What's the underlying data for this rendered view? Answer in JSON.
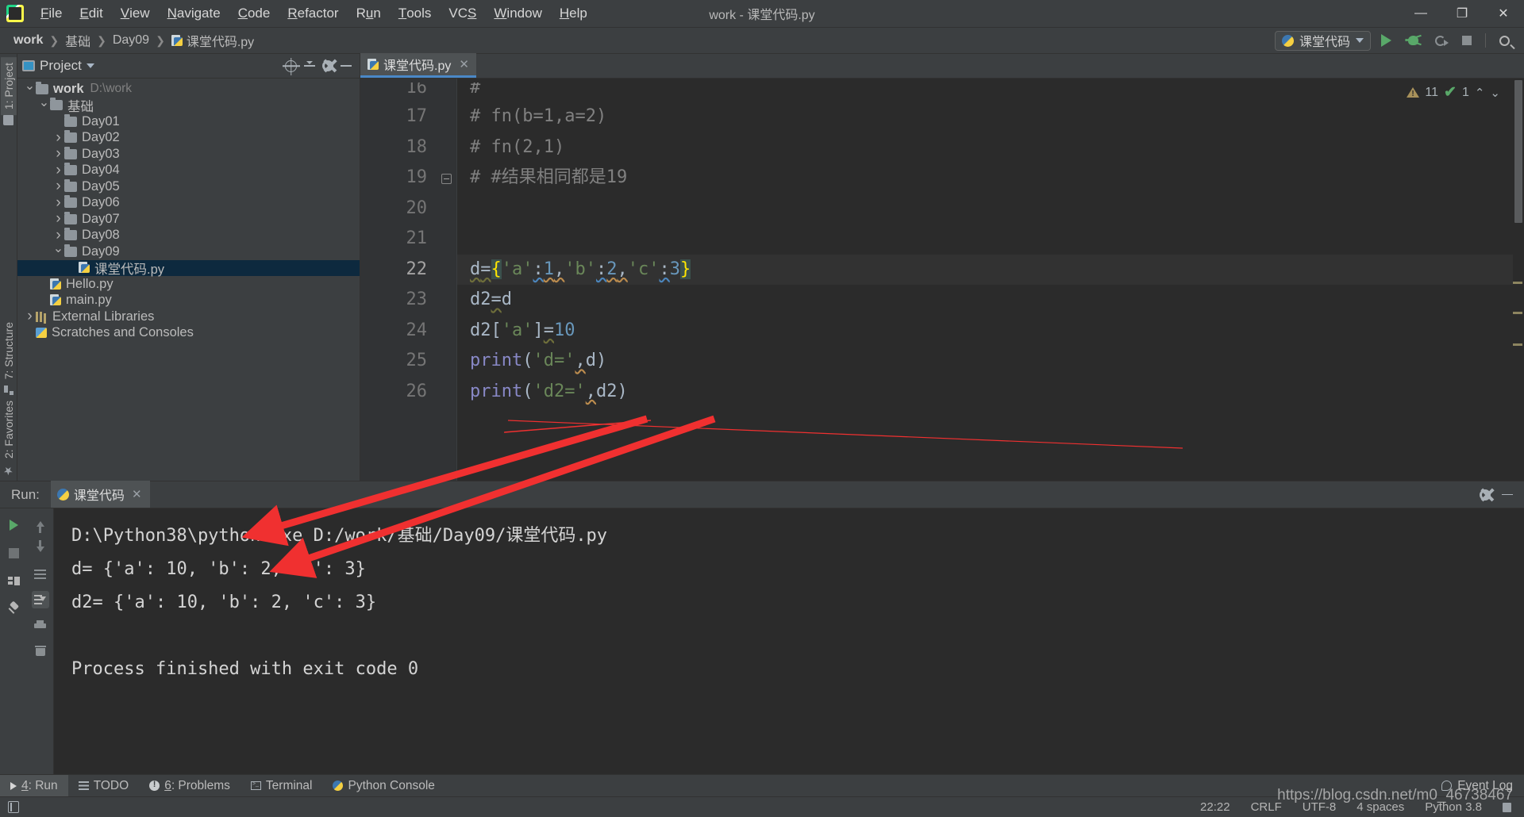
{
  "window": {
    "title": "work - 课堂代码.py",
    "app_icon": "pycharm-logo",
    "minimize": "—",
    "maximize": "❐",
    "close": "✕"
  },
  "menu": [
    {
      "label": "File"
    },
    {
      "label": "Edit"
    },
    {
      "label": "View"
    },
    {
      "label": "Navigate"
    },
    {
      "label": "Code"
    },
    {
      "label": "Refactor"
    },
    {
      "label": "Run"
    },
    {
      "label": "Tools"
    },
    {
      "label": "VCS"
    },
    {
      "label": "Window"
    },
    {
      "label": "Help"
    }
  ],
  "breadcrumb": {
    "items": [
      "work",
      "基础",
      "Day09"
    ],
    "file": "课堂代码.py",
    "separator": "❯"
  },
  "toolbar": {
    "run_config": "课堂代码",
    "run_button": "run-icon",
    "debug_button": "debug-icon",
    "coverage_button": "coverage-icon",
    "stop_button": "stop-icon",
    "search_button": "search-icon"
  },
  "left_strip": {
    "project_tab": "1: Project",
    "structure_tab": "7: Structure",
    "favorites_tab": "2: Favorites"
  },
  "project_panel": {
    "title": "Project",
    "tree": [
      {
        "label": "work",
        "path": "D:\\work",
        "depth": 0,
        "arrow": "down",
        "icon": "folder",
        "bold": true,
        "selected": false
      },
      {
        "label": "基础",
        "path": "",
        "depth": 1,
        "arrow": "down",
        "icon": "folder",
        "bold": false,
        "selected": false
      },
      {
        "label": "Day01",
        "path": "",
        "depth": 2,
        "arrow": "none",
        "icon": "folder",
        "bold": false,
        "selected": false
      },
      {
        "label": "Day02",
        "path": "",
        "depth": 2,
        "arrow": "right",
        "icon": "folder",
        "bold": false,
        "selected": false
      },
      {
        "label": "Day03",
        "path": "",
        "depth": 2,
        "arrow": "right",
        "icon": "folder",
        "bold": false,
        "selected": false
      },
      {
        "label": "Day04",
        "path": "",
        "depth": 2,
        "arrow": "right",
        "icon": "folder",
        "bold": false,
        "selected": false
      },
      {
        "label": "Day05",
        "path": "",
        "depth": 2,
        "arrow": "right",
        "icon": "folder",
        "bold": false,
        "selected": false
      },
      {
        "label": "Day06",
        "path": "",
        "depth": 2,
        "arrow": "right",
        "icon": "folder",
        "bold": false,
        "selected": false
      },
      {
        "label": "Day07",
        "path": "",
        "depth": 2,
        "arrow": "right",
        "icon": "folder",
        "bold": false,
        "selected": false
      },
      {
        "label": "Day08",
        "path": "",
        "depth": 2,
        "arrow": "right",
        "icon": "folder",
        "bold": false,
        "selected": false
      },
      {
        "label": "Day09",
        "path": "",
        "depth": 2,
        "arrow": "down",
        "icon": "folder",
        "bold": false,
        "selected": false
      },
      {
        "label": "课堂代码.py",
        "path": "",
        "depth": 3,
        "arrow": "none",
        "icon": "python",
        "bold": false,
        "selected": true
      },
      {
        "label": "Hello.py",
        "path": "",
        "depth": 1,
        "arrow": "none",
        "icon": "python",
        "bold": false,
        "selected": false
      },
      {
        "label": "main.py",
        "path": "",
        "depth": 1,
        "arrow": "none",
        "icon": "python",
        "bold": false,
        "selected": false
      },
      {
        "label": "External Libraries",
        "path": "",
        "depth": 0,
        "arrow": "right",
        "icon": "library",
        "bold": false,
        "selected": false
      },
      {
        "label": "Scratches and Consoles",
        "path": "",
        "depth": 0,
        "arrow": "none",
        "icon": "scratch",
        "bold": false,
        "selected": false
      }
    ]
  },
  "editor": {
    "tab": {
      "label": "课堂代码.py",
      "close": "✕"
    },
    "inspections": {
      "warning_count": "11",
      "check_count": "1",
      "up": "⌃",
      "down": "⌄"
    },
    "lines": [
      {
        "no": "16",
        "text": "#"
      },
      {
        "no": "17",
        "text": "# fn(b=1,a=2)"
      },
      {
        "no": "18",
        "text": "# fn(2,1)"
      },
      {
        "no": "19",
        "text": "# #结果相同都是19"
      },
      {
        "no": "20",
        "text": ""
      },
      {
        "no": "21",
        "text": ""
      },
      {
        "no": "22",
        "text": "d={'a':1,'b':2,'c':3}"
      },
      {
        "no": "23",
        "text": "d2=d"
      },
      {
        "no": "24",
        "text": "d2['a']=10"
      },
      {
        "no": "25",
        "text": "print('d=',d)"
      },
      {
        "no": "26",
        "text": "print('d2=',d2)"
      }
    ]
  },
  "run_panel": {
    "label": "Run:",
    "tab": {
      "label": "课堂代码",
      "close": "✕"
    },
    "settings_icon": "gear-icon",
    "minimize_icon": "minimize-icon",
    "console_lines": [
      "D:\\Python38\\python.exe D:/work/基础/Day09/课堂代码.py",
      "d= {'a': 10, 'b': 2, 'c': 3}",
      "d2= {'a': 10, 'b': 2, 'c': 3}",
      "",
      "Process finished with exit code 0"
    ]
  },
  "tool_window_bar": {
    "items": [
      {
        "label": "4: Run",
        "icon": "run-icon",
        "active": true
      },
      {
        "label": "TODO",
        "icon": "todo-icon",
        "active": false
      },
      {
        "label": "6: Problems",
        "icon": "problems-icon",
        "active": false
      },
      {
        "label": "Terminal",
        "icon": "terminal-icon",
        "active": false
      },
      {
        "label": "Python Console",
        "icon": "python-console-icon",
        "active": false
      }
    ],
    "event_log": "Event Log"
  },
  "status_bar": {
    "position": "22:22",
    "line_separator": "CRLF",
    "encoding": "UTF-8",
    "indent": "4 spaces",
    "interpreter": "Python 3.8"
  },
  "watermark": "https://blog.csdn.net/m0_46738467",
  "colors": {
    "accent": "#4a88c7",
    "selection": "#0d293e",
    "editor_bg": "#2b2b2b",
    "panel_bg": "#3c3f41",
    "green": "#59a869",
    "arrow_red": "#f03030"
  }
}
